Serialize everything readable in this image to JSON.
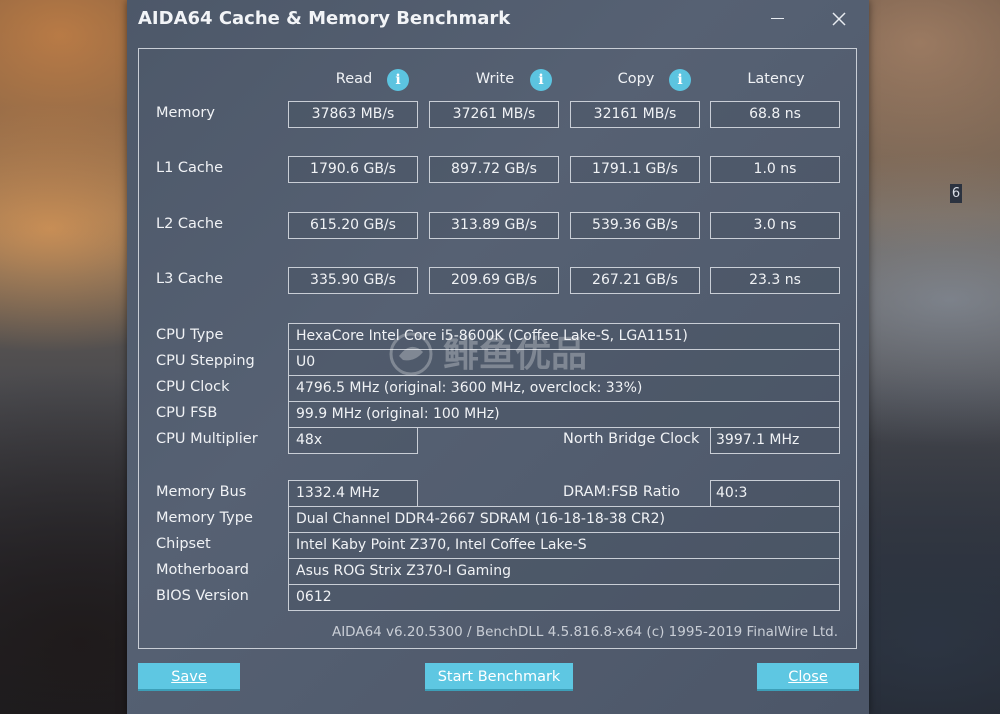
{
  "window": {
    "title": "AIDA64 Cache & Memory Benchmark",
    "minimize_icon": "minimize-icon",
    "close_icon": "close-icon"
  },
  "desktop": {
    "badge": "6"
  },
  "columns": {
    "read": "Read",
    "write": "Write",
    "copy": "Copy",
    "latency": "Latency",
    "info_icon_glyph": "i"
  },
  "benchmark": {
    "memory": {
      "label": "Memory",
      "read": "37863 MB/s",
      "write": "37261 MB/s",
      "copy": "32161 MB/s",
      "latency": "68.8 ns"
    },
    "l1": {
      "label": "L1 Cache",
      "read": "1790.6 GB/s",
      "write": "897.72 GB/s",
      "copy": "1791.1 GB/s",
      "latency": "1.0 ns"
    },
    "l2": {
      "label": "L2 Cache",
      "read": "615.20 GB/s",
      "write": "313.89 GB/s",
      "copy": "539.36 GB/s",
      "latency": "3.0 ns"
    },
    "l3": {
      "label": "L3 Cache",
      "read": "335.90 GB/s",
      "write": "209.69 GB/s",
      "copy": "267.21 GB/s",
      "latency": "23.3 ns"
    }
  },
  "cpu_info": {
    "type_label": "CPU Type",
    "type_value": "HexaCore Intel Core i5-8600K  (Coffee Lake-S, LGA1151)",
    "stepping_label": "CPU Stepping",
    "stepping_value": "U0",
    "clock_label": "CPU Clock",
    "clock_value": "4796.5 MHz  (original: 3600 MHz, overclock: 33%)",
    "fsb_label": "CPU FSB",
    "fsb_value": "99.9 MHz  (original: 100 MHz)",
    "multiplier_label": "CPU Multiplier",
    "multiplier_value": "48x",
    "nb_clock_label": "North Bridge Clock",
    "nb_clock_value": "3997.1 MHz"
  },
  "memory_info": {
    "bus_label": "Memory Bus",
    "bus_value": "1332.4 MHz",
    "ratio_label": "DRAM:FSB Ratio",
    "ratio_value": "40:3",
    "type_label": "Memory Type",
    "type_value": "Dual Channel DDR4-2667 SDRAM  (16-18-18-38 CR2)",
    "chipset_label": "Chipset",
    "chipset_value": "Intel Kaby Point Z370, Intel Coffee Lake-S",
    "motherboard_label": "Motherboard",
    "motherboard_value": "Asus ROG Strix Z370-I Gaming",
    "bios_label": "BIOS Version",
    "bios_value": "0612"
  },
  "footer": {
    "version_text": "AIDA64 v6.20.5300 / BenchDLL 4.5.816.8-x64  (c) 1995-2019 FinalWire Ltd."
  },
  "watermark": {
    "text": "鲱鱼优品"
  },
  "buttons": {
    "save_label": "Save",
    "start_label": "Start Benchmark",
    "close_label": "Close"
  }
}
